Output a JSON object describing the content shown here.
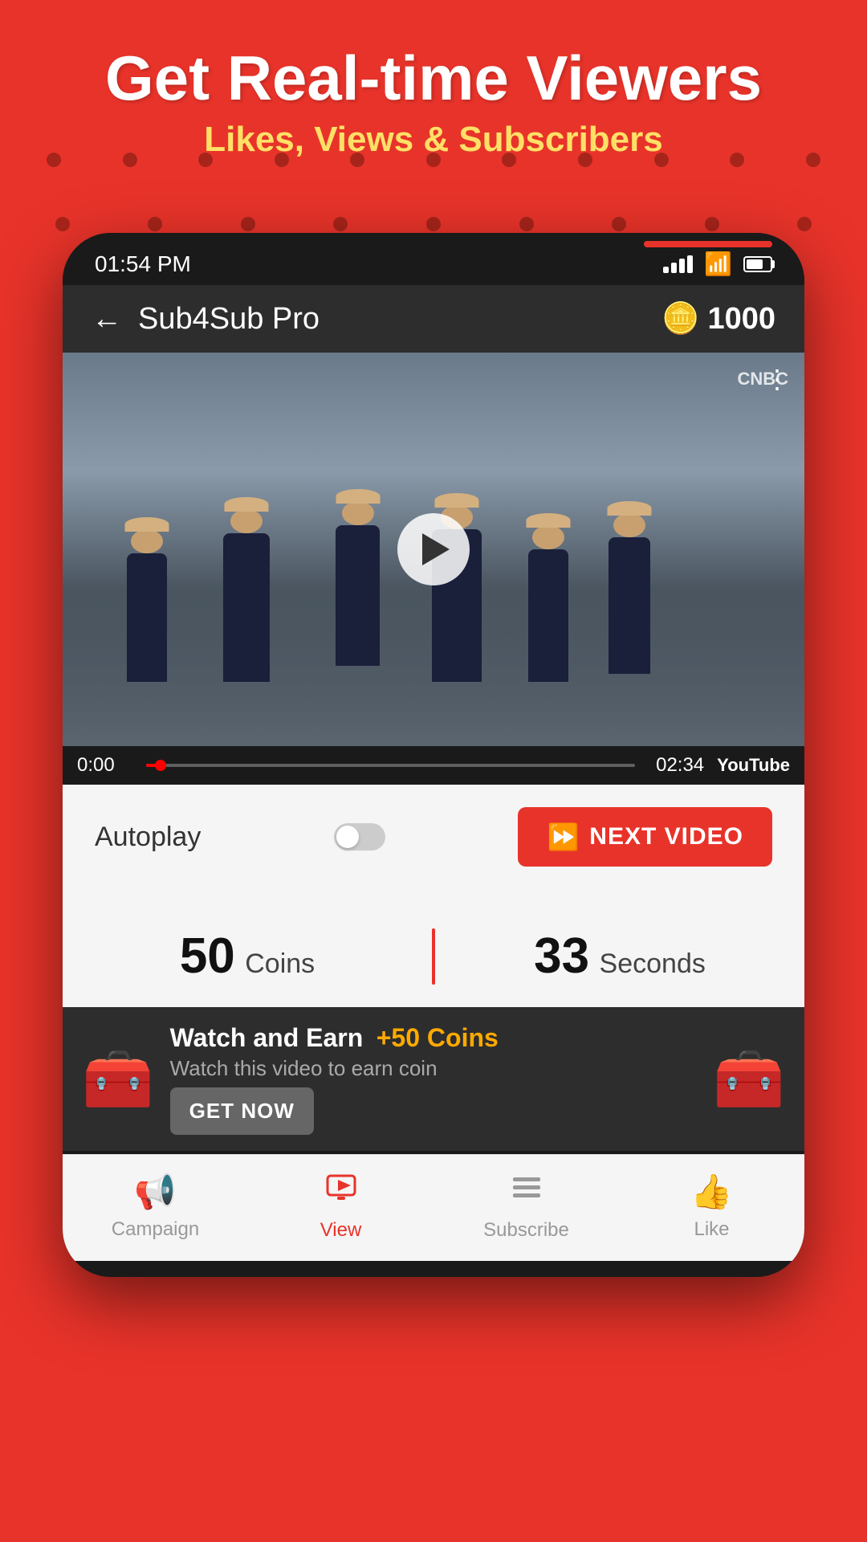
{
  "background": {
    "color": "#e8332a"
  },
  "header": {
    "title": "Get Real-time Viewers",
    "subtitle": "Likes, Views & Subscribers"
  },
  "status_bar": {
    "time": "01:54 PM"
  },
  "app_header": {
    "title": "Sub4Sub Pro",
    "coin_count": "1000",
    "back_label": "←"
  },
  "video": {
    "current_time": "0:00",
    "duration": "02:34",
    "watermark": "CNBC",
    "youtube_label": "YouTube"
  },
  "controls": {
    "autoplay_label": "Autoplay",
    "next_video_label": "NEXT VIDEO"
  },
  "stats": {
    "coins_number": "50",
    "coins_label": "Coins",
    "seconds_number": "33",
    "seconds_label": "Seconds"
  },
  "earn_banner": {
    "title": "Watch and Earn",
    "coins_text": "+50 Coins",
    "description": "Watch this video to earn coin",
    "cta_label": "GET NOW"
  },
  "bottom_nav": {
    "items": [
      {
        "label": "Campaign",
        "icon": "📢",
        "active": false
      },
      {
        "label": "View",
        "icon": "▶",
        "active": true
      },
      {
        "label": "Subscribe",
        "icon": "☰",
        "active": false
      },
      {
        "label": "Like",
        "icon": "👍",
        "active": false
      }
    ]
  }
}
